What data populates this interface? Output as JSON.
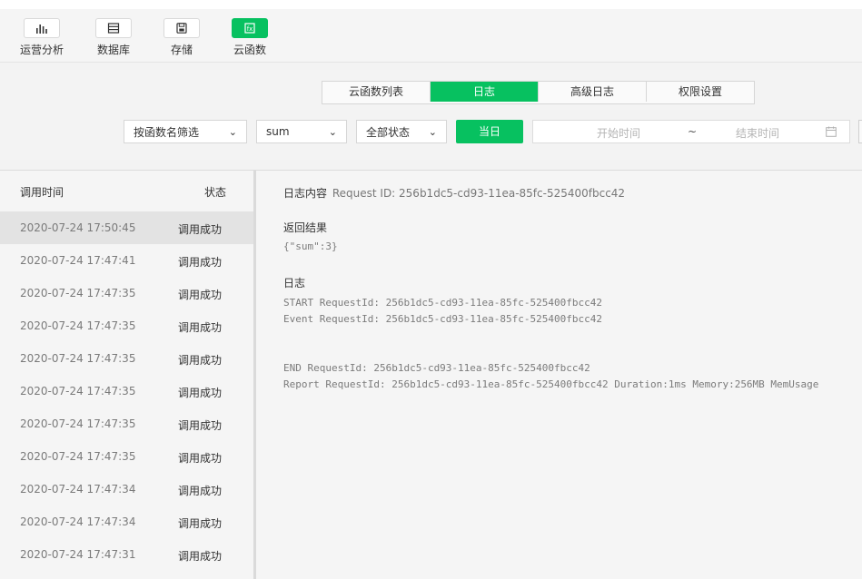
{
  "toolbar": {
    "items": [
      {
        "label": "运营分析",
        "icon": "bar-chart-icon"
      },
      {
        "label": "数据库",
        "icon": "database-icon"
      },
      {
        "label": "存储",
        "icon": "storage-icon"
      },
      {
        "label": "云函数",
        "icon": "cloud-function-icon",
        "active": true
      }
    ]
  },
  "tabs": [
    {
      "label": "云函数列表"
    },
    {
      "label": "日志",
      "active": true
    },
    {
      "label": "高级日志"
    },
    {
      "label": "权限设置"
    }
  ],
  "filters": {
    "function_filter": "按函数名筛选",
    "function_name": "sum",
    "status": "全部状态",
    "today_button": "当日",
    "start_placeholder": "开始时间",
    "range_sep": "~",
    "end_placeholder": "结束时间"
  },
  "log_list": {
    "header_time": "调用时间",
    "header_status": "状态",
    "rows": [
      {
        "time": "2020-07-24 17:50:45",
        "status": "调用成功"
      },
      {
        "time": "2020-07-24 17:47:41",
        "status": "调用成功"
      },
      {
        "time": "2020-07-24 17:47:35",
        "status": "调用成功"
      },
      {
        "time": "2020-07-24 17:47:35",
        "status": "调用成功"
      },
      {
        "time": "2020-07-24 17:47:35",
        "status": "调用成功"
      },
      {
        "time": "2020-07-24 17:47:35",
        "status": "调用成功"
      },
      {
        "time": "2020-07-24 17:47:35",
        "status": "调用成功"
      },
      {
        "time": "2020-07-24 17:47:35",
        "status": "调用成功"
      },
      {
        "time": "2020-07-24 17:47:34",
        "status": "调用成功"
      },
      {
        "time": "2020-07-24 17:47:34",
        "status": "调用成功"
      },
      {
        "time": "2020-07-24 17:47:31",
        "status": "调用成功"
      }
    ]
  },
  "detail": {
    "title": "日志内容",
    "request_id": "Request ID: 256b1dc5-cd93-11ea-85fc-525400fbcc42",
    "result_label": "返回结果",
    "result_value": "{\"sum\":3}",
    "log_label": "日志",
    "log_lines": [
      "START RequestId: 256b1dc5-cd93-11ea-85fc-525400fbcc42",
      "Event RequestId: 256b1dc5-cd93-11ea-85fc-525400fbcc42",
      "END RequestId: 256b1dc5-cd93-11ea-85fc-525400fbcc42",
      "Report RequestId: 256b1dc5-cd93-11ea-85fc-525400fbcc42 Duration:1ms Memory:256MB MemUsage"
    ]
  },
  "colors": {
    "accent": "#07c160"
  }
}
